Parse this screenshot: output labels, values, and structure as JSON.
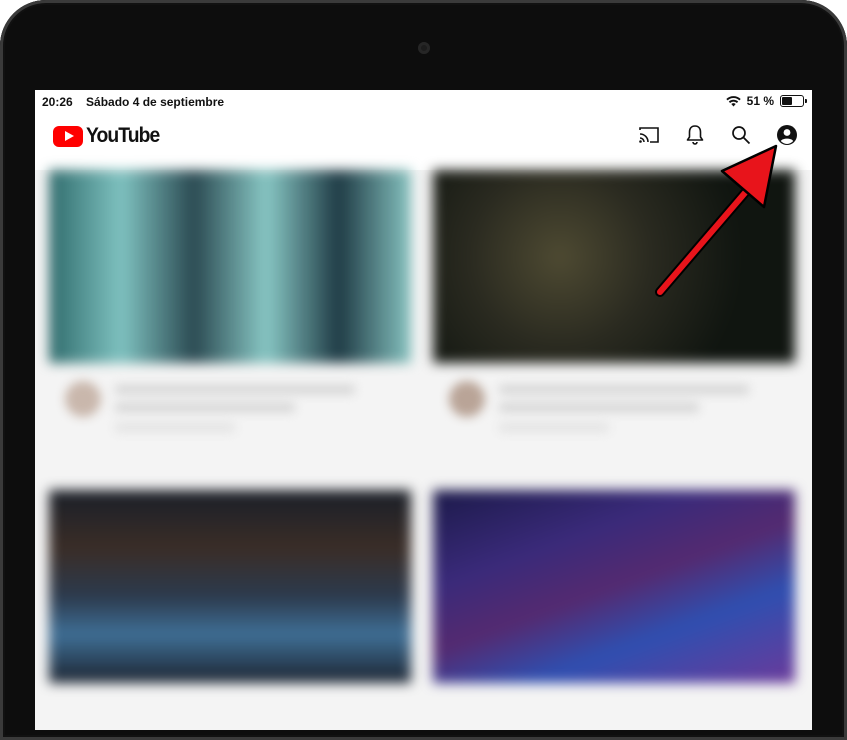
{
  "status_bar": {
    "time": "20:26",
    "date": "Sábado 4 de septiembre",
    "battery_text": "51 %",
    "battery_level": 0.51
  },
  "app": {
    "logo_text": "YouTube",
    "icons": [
      "cast-icon",
      "bell-icon",
      "search-icon",
      "account-icon"
    ]
  },
  "colors": {
    "brand_red": "#ff0000",
    "annotation_arrow": "#e8141b"
  },
  "feed": {
    "video_count": 4
  }
}
